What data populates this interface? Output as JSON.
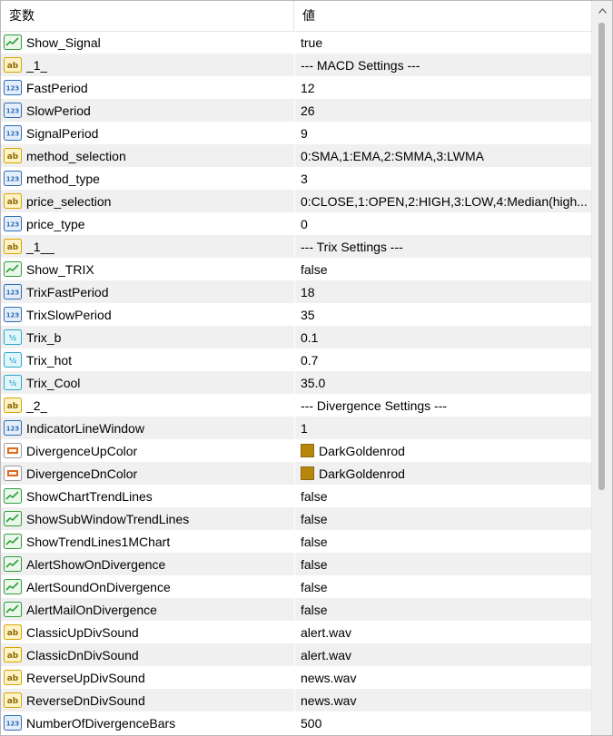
{
  "header": {
    "name_col": "変数",
    "value_col": "値"
  },
  "colors": {
    "swatch": "#b8860b",
    "bool_icon": "#2e9e3c",
    "int_icon": "#2f6db5",
    "str_icon": "#d9a300",
    "dbl_icon": "#2ba6c9",
    "color_icon": "#e06a1a"
  },
  "rows": [
    {
      "type": "bool",
      "name": "Show_Signal",
      "value": "true"
    },
    {
      "type": "str",
      "name": "_1_",
      "value": "--- MACD Settings ---"
    },
    {
      "type": "int",
      "name": "FastPeriod",
      "value": "12"
    },
    {
      "type": "int",
      "name": "SlowPeriod",
      "value": "26"
    },
    {
      "type": "int",
      "name": "SignalPeriod",
      "value": "9"
    },
    {
      "type": "str",
      "name": "method_selection",
      "value": "0:SMA,1:EMA,2:SMMA,3:LWMA"
    },
    {
      "type": "int",
      "name": "method_type",
      "value": "3"
    },
    {
      "type": "str",
      "name": "price_selection",
      "value": "0:CLOSE,1:OPEN,2:HIGH,3:LOW,4:Median(high..."
    },
    {
      "type": "int",
      "name": "price_type",
      "value": "0"
    },
    {
      "type": "str",
      "name": "_1__",
      "value": "--- Trix Settings ---"
    },
    {
      "type": "bool",
      "name": "Show_TRIX",
      "value": "false"
    },
    {
      "type": "int",
      "name": "TrixFastPeriod",
      "value": "18"
    },
    {
      "type": "int",
      "name": "TrixSlowPeriod",
      "value": "35"
    },
    {
      "type": "dbl",
      "name": "Trix_b",
      "value": "0.1"
    },
    {
      "type": "dbl",
      "name": "Trix_hot",
      "value": "0.7"
    },
    {
      "type": "dbl",
      "name": "Trix_Cool",
      "value": "35.0"
    },
    {
      "type": "str",
      "name": "_2_",
      "value": "--- Divergence Settings ---"
    },
    {
      "type": "int",
      "name": "IndicatorLineWindow",
      "value": "1"
    },
    {
      "type": "color",
      "name": "DivergenceUpColor",
      "value": "DarkGoldenrod"
    },
    {
      "type": "color",
      "name": "DivergenceDnColor",
      "value": "DarkGoldenrod"
    },
    {
      "type": "bool",
      "name": "ShowChartTrendLines",
      "value": "false"
    },
    {
      "type": "bool",
      "name": "ShowSubWindowTrendLines",
      "value": "false"
    },
    {
      "type": "bool",
      "name": "ShowTrendLines1MChart",
      "value": "false"
    },
    {
      "type": "bool",
      "name": "AlertShowOnDivergence",
      "value": "false"
    },
    {
      "type": "bool",
      "name": "AlertSoundOnDivergence",
      "value": "false"
    },
    {
      "type": "bool",
      "name": "AlertMailOnDivergence",
      "value": "false"
    },
    {
      "type": "str",
      "name": "ClassicUpDivSound",
      "value": "alert.wav"
    },
    {
      "type": "str",
      "name": "ClassicDnDivSound",
      "value": "alert.wav"
    },
    {
      "type": "str",
      "name": "ReverseUpDivSound",
      "value": "news.wav"
    },
    {
      "type": "str",
      "name": "ReverseDnDivSound",
      "value": "news.wav"
    },
    {
      "type": "int",
      "name": "NumberOfDivergenceBars",
      "value": "500"
    }
  ]
}
